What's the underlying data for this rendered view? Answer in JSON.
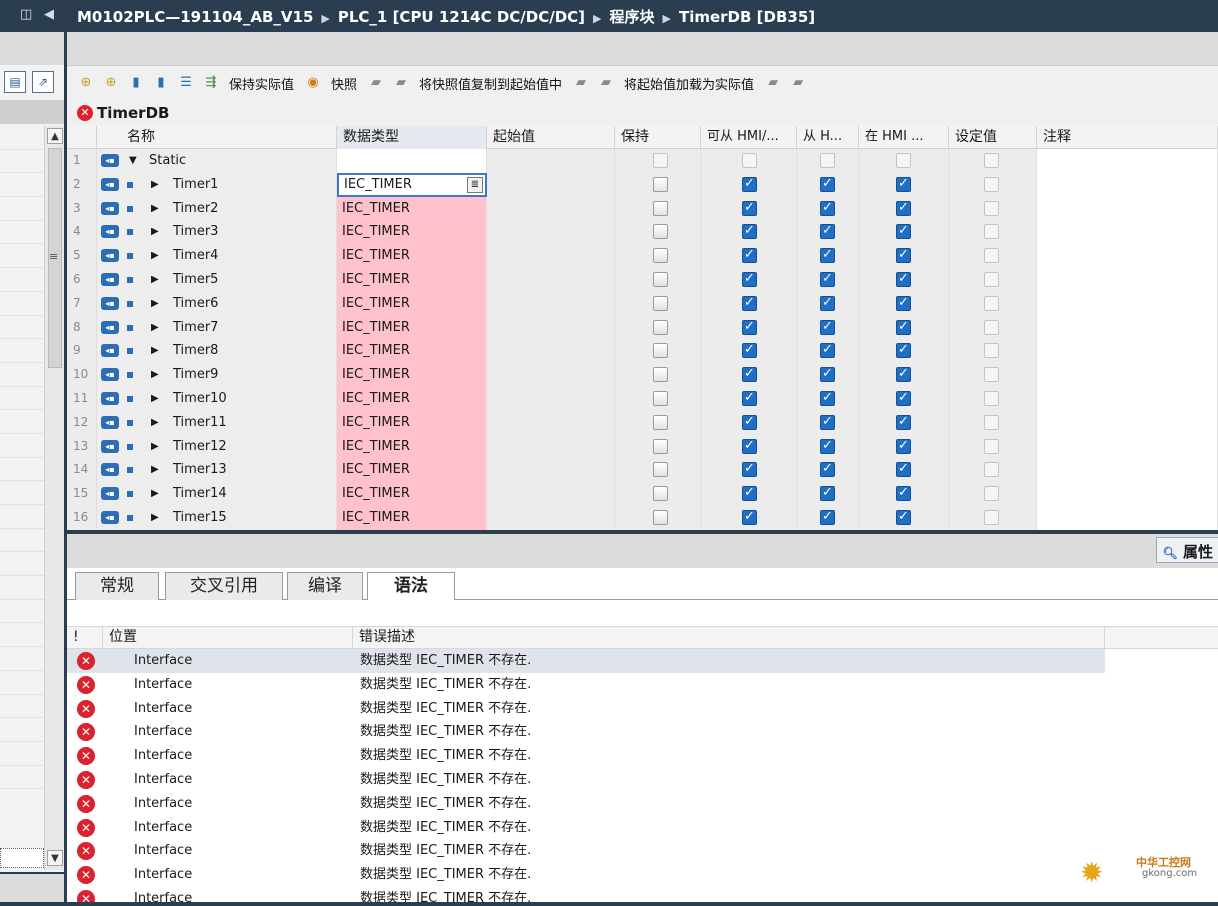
{
  "title_path": [
    "M0102PLC—191104_AB_V15",
    "PLC_1 [CPU 1214C DC/DC/DC]",
    "程序块",
    "TimerDB [DB35]"
  ],
  "toolbar": {
    "keep_actual": "保持实际值",
    "snapshot": "快照",
    "copy_snapshot": "将快照值复制到起始值中",
    "load_start": "将起始值加载为实际值"
  },
  "db_title": "TimerDB",
  "columns": [
    "名称",
    "数据类型",
    "起始值",
    "保持",
    "可从 HMI/...",
    "从 H...",
    "在 HMI ...",
    "设定值",
    "注释"
  ],
  "rows": [
    {
      "num": "1",
      "name": "Static",
      "type": ""
    },
    {
      "num": "2",
      "name": "Timer1",
      "type": "IEC_TIMER"
    },
    {
      "num": "3",
      "name": "Timer2",
      "type": "IEC_TIMER"
    },
    {
      "num": "4",
      "name": "Timer3",
      "type": "IEC_TIMER"
    },
    {
      "num": "5",
      "name": "Timer4",
      "type": "IEC_TIMER"
    },
    {
      "num": "6",
      "name": "Timer5",
      "type": "IEC_TIMER"
    },
    {
      "num": "7",
      "name": "Timer6",
      "type": "IEC_TIMER"
    },
    {
      "num": "8",
      "name": "Timer7",
      "type": "IEC_TIMER"
    },
    {
      "num": "9",
      "name": "Timer8",
      "type": "IEC_TIMER"
    },
    {
      "num": "10",
      "name": "Timer9",
      "type": "IEC_TIMER"
    },
    {
      "num": "11",
      "name": "Timer10",
      "type": "IEC_TIMER"
    },
    {
      "num": "12",
      "name": "Timer11",
      "type": "IEC_TIMER"
    },
    {
      "num": "13",
      "name": "Timer12",
      "type": "IEC_TIMER"
    },
    {
      "num": "14",
      "name": "Timer13",
      "type": "IEC_TIMER"
    },
    {
      "num": "15",
      "name": "Timer14",
      "type": "IEC_TIMER"
    },
    {
      "num": "16",
      "name": "Timer15",
      "type": "IEC_TIMER"
    }
  ],
  "inspector": {
    "properties_label": "属性",
    "tabs": [
      "常规",
      "交叉引用",
      "编译",
      "语法"
    ],
    "active_tab": "语法",
    "error_columns": [
      "!",
      "位置",
      "错误描述"
    ],
    "errors": [
      {
        "loc": "Interface",
        "desc": "数据类型 IEC_TIMER 不存在."
      },
      {
        "loc": "Interface",
        "desc": "数据类型 IEC_TIMER 不存在."
      },
      {
        "loc": "Interface",
        "desc": "数据类型 IEC_TIMER 不存在."
      },
      {
        "loc": "Interface",
        "desc": "数据类型 IEC_TIMER 不存在."
      },
      {
        "loc": "Interface",
        "desc": "数据类型 IEC_TIMER 不存在."
      },
      {
        "loc": "Interface",
        "desc": "数据类型 IEC_TIMER 不存在."
      },
      {
        "loc": "Interface",
        "desc": "数据类型 IEC_TIMER 不存在."
      },
      {
        "loc": "Interface",
        "desc": "数据类型 IEC_TIMER 不存在."
      },
      {
        "loc": "Interface",
        "desc": "数据类型 IEC_TIMER 不存在."
      },
      {
        "loc": "Interface",
        "desc": "数据类型 IEC_TIMER 不存在."
      },
      {
        "loc": "Interface",
        "desc": "数据类型 IEC_TIMER 不存在."
      }
    ]
  },
  "watermark": {
    "brand": "中华工控网",
    "site": "gkong.com"
  },
  "colors": {
    "titlebar": "#2b3d50",
    "type_cell": "#ffc1cc",
    "check": "#1f6fc6",
    "error": "#d9232e"
  }
}
